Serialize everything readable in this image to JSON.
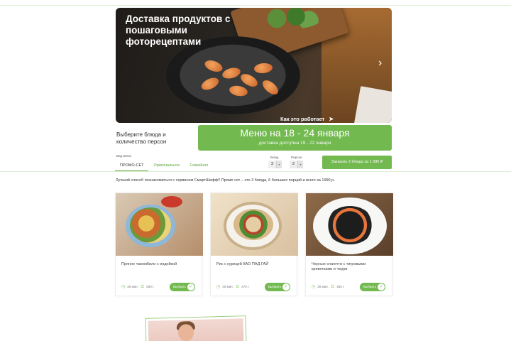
{
  "hero": {
    "title": "Доставка продуктов с пошаговыми фоторецептами",
    "how_it_works": "Как это работает",
    "next_arrow": "›"
  },
  "menu_section": {
    "choose_text": "Выберите блюда и количество персон",
    "banner_title": "Меню на 18 - 24 января",
    "banner_subtitle": "доставка доступна 19 - 22 января"
  },
  "filters": {
    "menu_type_label": "Вид меню",
    "tabs": [
      {
        "label": "ПРОМО-СЕТ",
        "active": true
      },
      {
        "label": "Оригинальное",
        "active": false
      },
      {
        "label": "Семейное",
        "active": false
      }
    ],
    "dishes_label": "Блюд",
    "dishes_value": "3",
    "persons_label": "Персон",
    "persons_value": "2",
    "order_button": "Заказать 3 блюда за 1 990 ₽"
  },
  "promo_text": "Лучший способ познакомиться с сервисом СмартШефф!! Промо сет – это 3 блюда, 6 больших порций и всего за 1990 р.",
  "dishes": [
    {
      "name": "Пряное чакомбили с индейкой",
      "time": "30 мин.",
      "weight": "500 г.",
      "button": "Выбрать"
    },
    {
      "name": "Рис с курицей КАО ПАД ГАЙ",
      "time": "30 мин.",
      "weight": "470 г.",
      "button": "Выбрать"
    },
    {
      "name": "Черные спагетти с тигровыми креветками и черри",
      "time": "30 мин.",
      "weight": "450 г.",
      "button": "Выбрать"
    }
  ],
  "colors": {
    "accent": "#72b94f",
    "tab_text": "#5aa83a",
    "hero_bg": "#2a2622"
  },
  "icons": {
    "clock": "clock-icon",
    "weight": "scale-icon",
    "check": "check-icon",
    "play": "play-icon"
  }
}
